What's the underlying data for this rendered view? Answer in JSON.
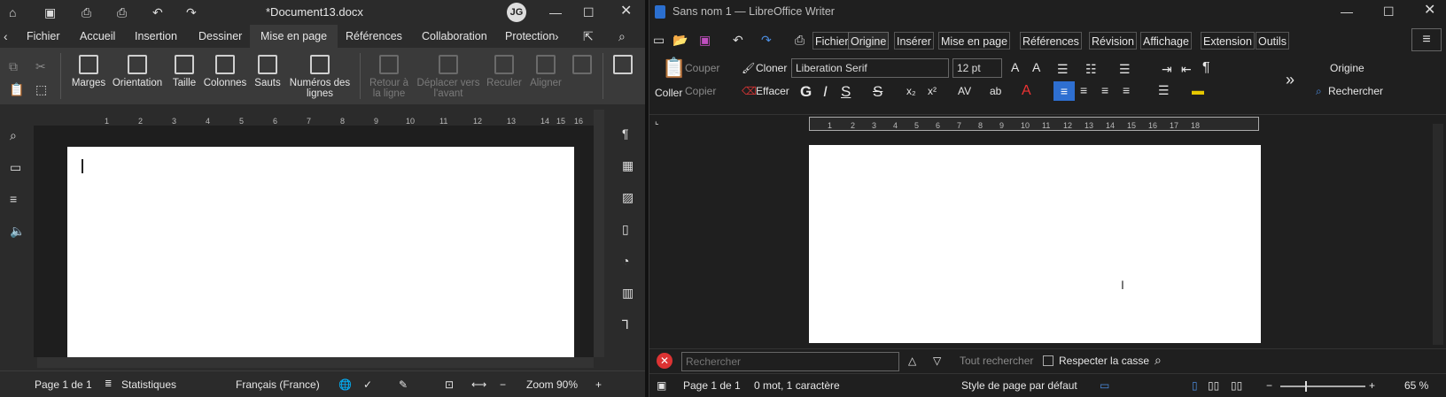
{
  "left": {
    "title": "*Document13.docx",
    "avatar": "JG",
    "menu": [
      "Fichier",
      "Accueil",
      "Insertion",
      "Dessiner",
      "Mise en page",
      "Références",
      "Collaboration",
      "Protection"
    ],
    "ribbon": {
      "margins": "Marges",
      "orientation": "Orientation",
      "size": "Taille",
      "columns": "Colonnes",
      "breaks": "Sauts",
      "line_numbers": "Numéros des lignes",
      "wrap": "Retour à la ligne",
      "bring_forward": "Déplacer vers l'avant",
      "send_back": "Reculer",
      "align": "Aligner"
    },
    "ruler": [
      "1",
      "2",
      "3",
      "4",
      "5",
      "6",
      "7",
      "8",
      "9",
      "10",
      "11",
      "12",
      "13",
      "14",
      "15",
      "16"
    ],
    "status": {
      "page": "Page 1 de 1",
      "stats": "Statistiques",
      "language": "Français (France)",
      "zoom": "Zoom 90%"
    }
  },
  "right": {
    "title": "Sans nom 1 — LibreOffice Writer",
    "menu": [
      "Fichier",
      "Origine",
      "Insérer",
      "Mise en page",
      "Références",
      "Révision",
      "Affichage",
      "Extension",
      "Outils"
    ],
    "toolbar": {
      "paste": "Coller",
      "cut": "Couper",
      "copy": "Copier",
      "clone": "Cloner",
      "clear": "Effacer",
      "font": "Liberation Serif",
      "size": "12 pt",
      "bold": "G",
      "italic": "I",
      "underline": "S",
      "strike": "S",
      "style": "Origine",
      "search": "Rechercher"
    },
    "ruler": [
      "1",
      "2",
      "3",
      "4",
      "5",
      "6",
      "7",
      "8",
      "9",
      "10",
      "11",
      "12",
      "13",
      "14",
      "15",
      "16",
      "17",
      "18"
    ],
    "find": {
      "placeholder": "Rechercher",
      "find_all": "Tout rechercher",
      "match_case": "Respecter la casse"
    },
    "status": {
      "page": "Page 1 de 1",
      "words": "0 mot, 1 caractère",
      "page_style": "Style de page par défaut",
      "zoom": "65 %"
    }
  }
}
